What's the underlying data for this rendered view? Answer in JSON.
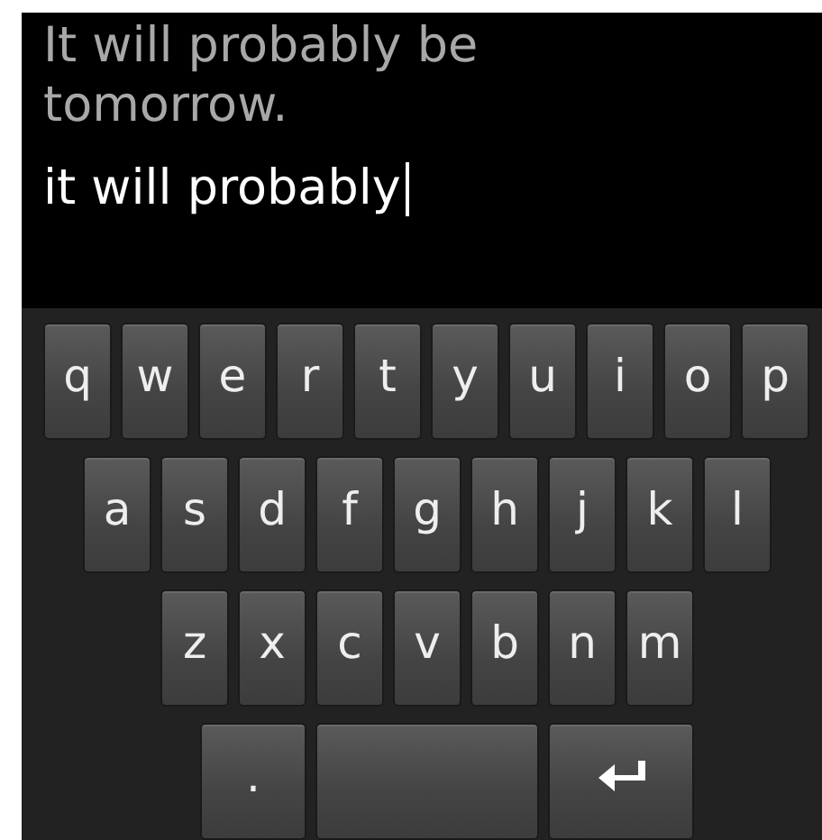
{
  "prompt": "It will probably be tomorrow.",
  "input": {
    "value": "it will probably"
  },
  "keyboard": {
    "rows": [
      {
        "keys": [
          {
            "kind": "char",
            "label": "q"
          },
          {
            "kind": "char",
            "label": "w"
          },
          {
            "kind": "char",
            "label": "e"
          },
          {
            "kind": "char",
            "label": "r"
          },
          {
            "kind": "char",
            "label": "t"
          },
          {
            "kind": "char",
            "label": "y"
          },
          {
            "kind": "char",
            "label": "u"
          },
          {
            "kind": "char",
            "label": "i"
          },
          {
            "kind": "char",
            "label": "o"
          },
          {
            "kind": "char",
            "label": "p"
          }
        ]
      },
      {
        "keys": [
          {
            "kind": "char",
            "label": "a"
          },
          {
            "kind": "char",
            "label": "s"
          },
          {
            "kind": "char",
            "label": "d"
          },
          {
            "kind": "char",
            "label": "f"
          },
          {
            "kind": "char",
            "label": "g"
          },
          {
            "kind": "char",
            "label": "h"
          },
          {
            "kind": "char",
            "label": "j"
          },
          {
            "kind": "char",
            "label": "k"
          },
          {
            "kind": "char",
            "label": "l"
          }
        ]
      },
      {
        "keys": [
          {
            "kind": "char",
            "label": "z"
          },
          {
            "kind": "char",
            "label": "x"
          },
          {
            "kind": "char",
            "label": "c"
          },
          {
            "kind": "char",
            "label": "v"
          },
          {
            "kind": "char",
            "label": "b"
          },
          {
            "kind": "char",
            "label": "n"
          },
          {
            "kind": "char",
            "label": "m"
          }
        ]
      },
      {
        "keys": [
          {
            "kind": "period",
            "label": "."
          },
          {
            "kind": "space"
          },
          {
            "kind": "enter"
          }
        ]
      }
    ]
  }
}
